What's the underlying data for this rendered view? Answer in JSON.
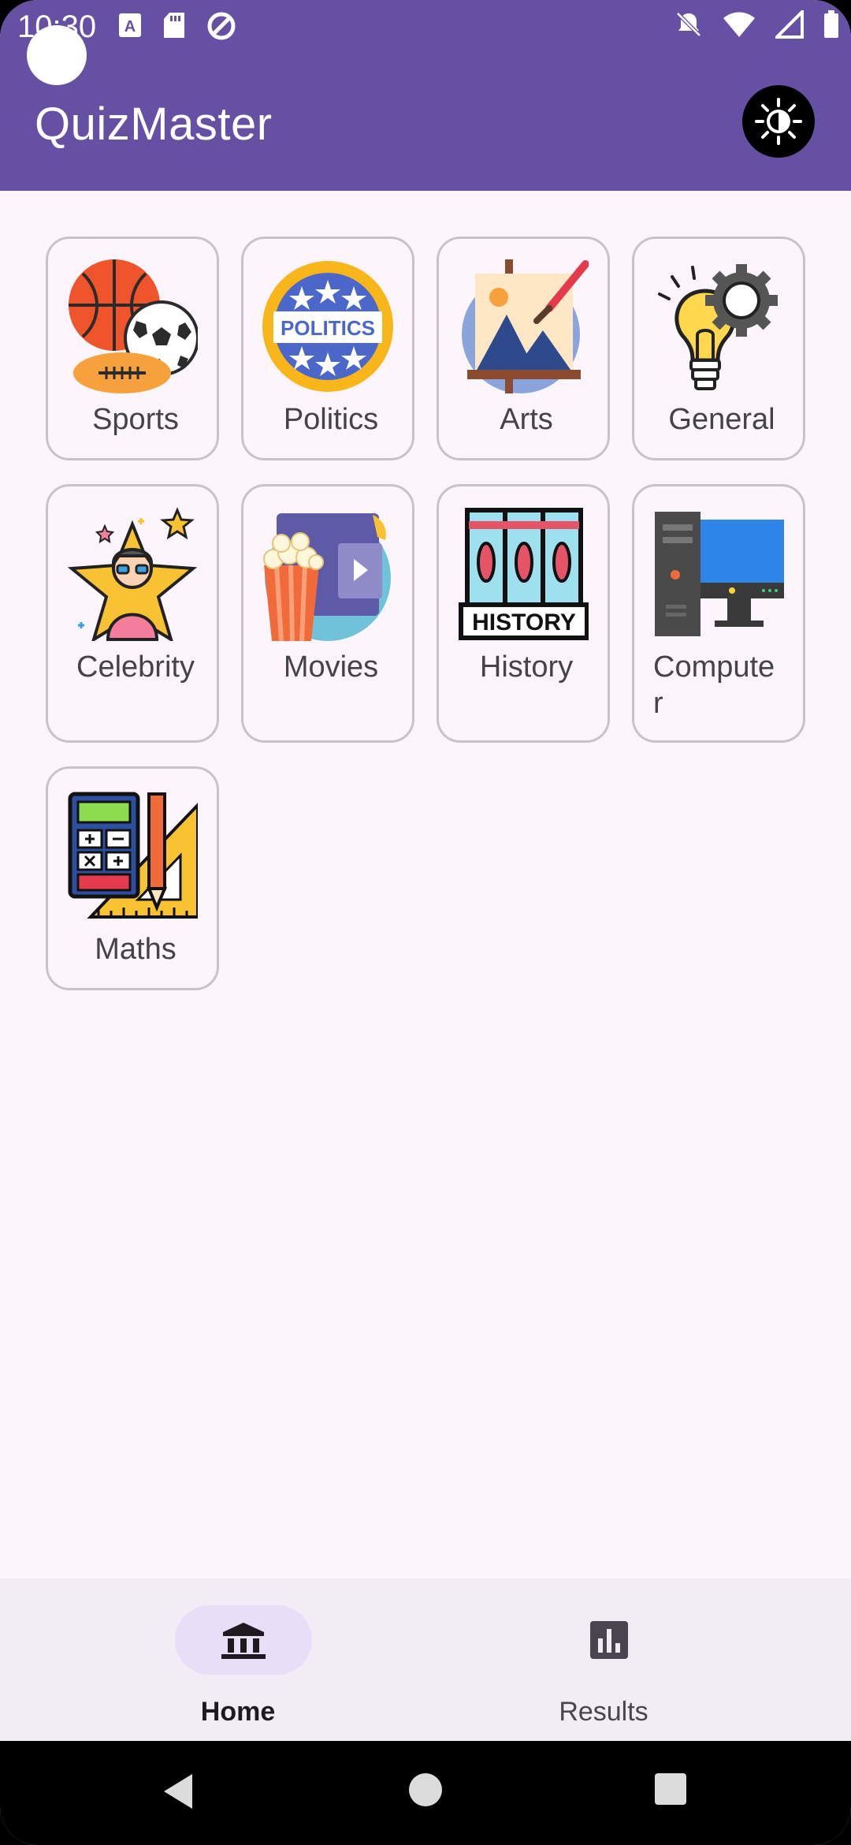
{
  "status_bar": {
    "time": "10:30",
    "icons": [
      "keyboard-a-icon",
      "sd-card-icon",
      "data-saver-icon",
      "do-not-disturb-off-icon",
      "wifi-icon",
      "signal-icon",
      "battery-icon"
    ]
  },
  "app_bar": {
    "title": "QuizMaster",
    "theme_toggle_icon": "brightness-icon"
  },
  "categories": [
    {
      "label": "Sports",
      "icon": "sports-balls-icon"
    },
    {
      "label": "Politics",
      "icon": "politics-badge-icon"
    },
    {
      "label": "Arts",
      "icon": "easel-painting-icon"
    },
    {
      "label": "General",
      "icon": "lightbulb-gear-icon"
    },
    {
      "label": "Celebrity",
      "icon": "celebrity-star-icon"
    },
    {
      "label": "Movies",
      "icon": "popcorn-screen-icon"
    },
    {
      "label": "History",
      "icon": "history-books-icon"
    },
    {
      "label": "Compute\nr",
      "icon": "computer-desktop-icon"
    },
    {
      "label": "Maths",
      "icon": "calculator-ruler-icon"
    }
  ],
  "bottom_nav": {
    "items": [
      {
        "label": "Home",
        "icon": "bank-icon",
        "active": true
      },
      {
        "label": "Results",
        "icon": "bar-chart-icon",
        "active": false
      }
    ]
  },
  "colors": {
    "primary": "#6650a4",
    "background": "#fcf5fc",
    "nav_background": "#f2ecf4",
    "nav_indicator": "#e8def8"
  }
}
